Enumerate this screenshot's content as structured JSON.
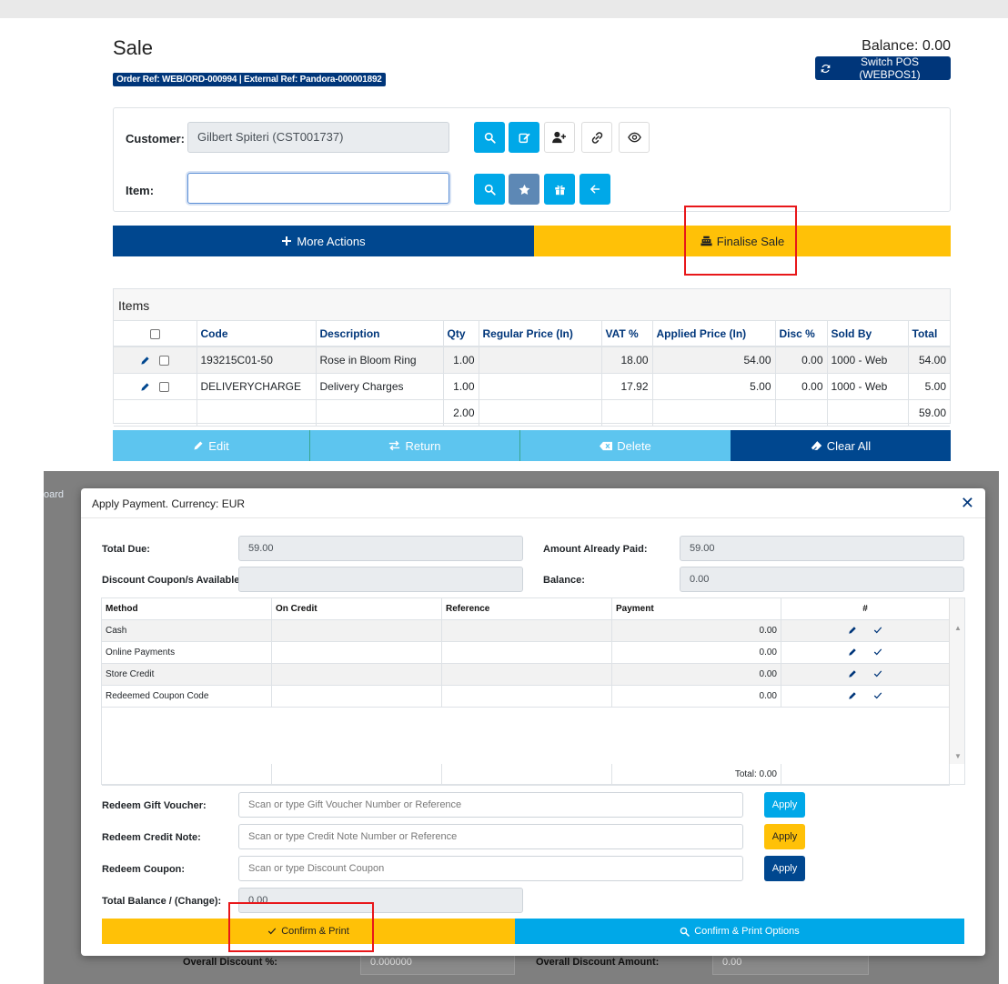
{
  "sale": {
    "title": "Sale",
    "ref": "Order Ref: WEB/ORD-000994 | External Ref: Pandora-000001892",
    "balance": "Balance: 0.00",
    "switch_pos": "Switch POS (WEBPOS1)",
    "customer_label": "Customer:",
    "customer_value": "Gilbert Spiteri (CST001737)",
    "item_label": "Item:",
    "item_value": "",
    "more_actions": "More Actions",
    "finalise": "Finalise Sale"
  },
  "items": {
    "title": "Items",
    "columns": [
      "Code",
      "Description",
      "Qty",
      "Regular Price (In)",
      "VAT %",
      "Applied Price (In)",
      "Disc %",
      "Sold By",
      "Total"
    ],
    "rows": [
      {
        "code": "193215C01-50",
        "description": "Rose in Bloom Ring",
        "qty": "1.00",
        "regular": "",
        "vat": "18.00",
        "applied": "54.00",
        "disc": "0.00",
        "sold_by": "1000 - Web",
        "total": "54.00"
      },
      {
        "code": "DELIVERYCHARGE",
        "description": "Delivery Charges",
        "qty": "1.00",
        "regular": "",
        "vat": "17.92",
        "applied": "5.00",
        "disc": "0.00",
        "sold_by": "1000 - Web",
        "total": "5.00"
      }
    ],
    "totals": {
      "qty": "2.00",
      "total": "59.00"
    }
  },
  "actions": {
    "edit": "Edit",
    "return": "Return",
    "delete": "Delete",
    "clear_all": "Clear All"
  },
  "background": {
    "dashboard_fragment": "oard",
    "overall_discount_pct_label": "Overall Discount %:",
    "overall_discount_pct_value": "0.000000",
    "overall_discount_amount_label": "Overall Discount Amount:",
    "overall_discount_amount_value": "0.00"
  },
  "modal": {
    "title": "Apply Payment. Currency: EUR",
    "total_due_label": "Total Due:",
    "total_due_value": "59.00",
    "already_paid_label": "Amount Already Paid:",
    "already_paid_value": "59.00",
    "coupons_label": "Discount Coupon/s Available:",
    "coupons_value": "",
    "balance_label": "Balance:",
    "balance_value": "0.00",
    "grid": {
      "columns": [
        "Method",
        "On Credit",
        "Reference",
        "Payment",
        "#"
      ],
      "rows": [
        {
          "method": "Cash",
          "on_credit": "",
          "reference": "",
          "payment": "0.00"
        },
        {
          "method": "Online Payments",
          "on_credit": "",
          "reference": "",
          "payment": "0.00"
        },
        {
          "method": "Store Credit",
          "on_credit": "",
          "reference": "",
          "payment": "0.00"
        },
        {
          "method": "Redeemed Coupon Code",
          "on_credit": "",
          "reference": "",
          "payment": "0.00"
        }
      ],
      "total": "Total: 0.00"
    },
    "gift_label": "Redeem Gift Voucher:",
    "gift_placeholder": "Scan or type Gift Voucher Number or Reference",
    "credit_label": "Redeem Credit Note:",
    "credit_placeholder": "Scan or type Credit Note Number or Reference",
    "coupon_label": "Redeem Coupon:",
    "coupon_placeholder": "Scan or type Discount Coupon",
    "apply": "Apply",
    "total_balance_label": "Total Balance / (Change):",
    "total_balance_value": "0.00",
    "confirm_print": "Confirm & Print",
    "confirm_print_options": "Confirm & Print Options"
  },
  "colors": {
    "navy": "#00367a",
    "dark_blue": "#00478f",
    "light_blue": "#00a8e8",
    "sky": "#5dc5ef",
    "yellow": "#ffc107",
    "highlight_red": "#e8171a"
  }
}
